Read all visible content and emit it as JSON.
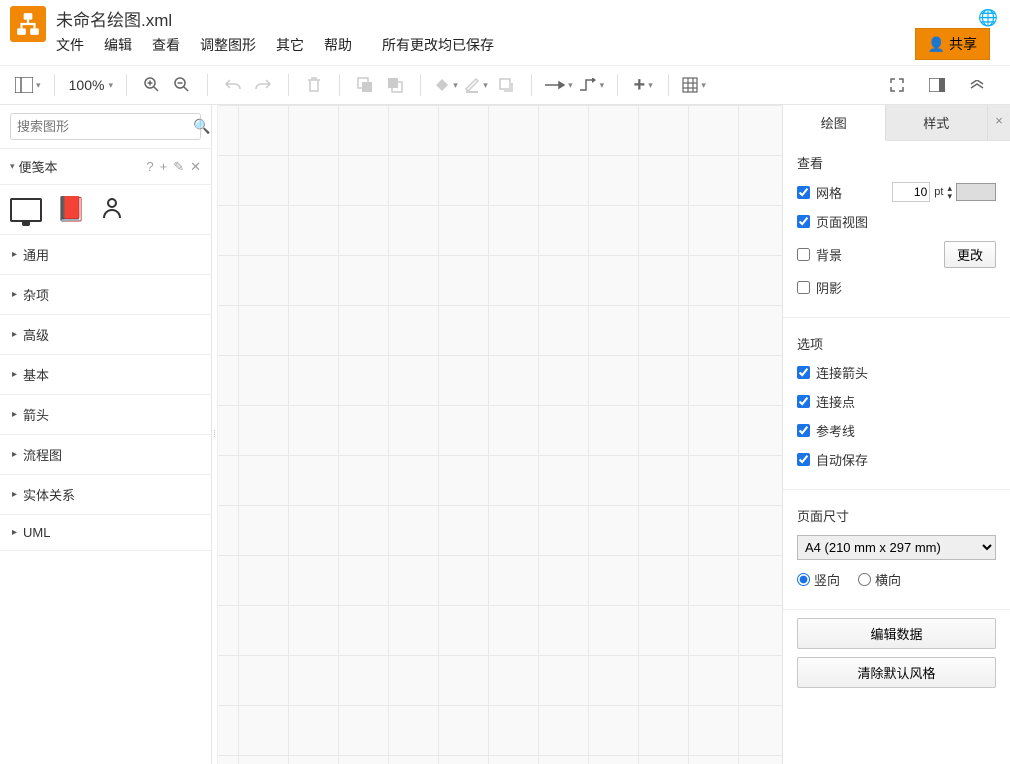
{
  "header": {
    "title": "未命名绘图.xml",
    "menu": [
      "文件",
      "编辑",
      "查看",
      "调整图形",
      "其它",
      "帮助"
    ],
    "save_status": "所有更改均已保存",
    "share_label": "共享"
  },
  "toolbar": {
    "zoom": "100%"
  },
  "sidebar": {
    "search_placeholder": "搜索图形",
    "notebook_label": "便笺本",
    "notebook_actions": [
      "?",
      "+",
      "✎",
      "✕"
    ],
    "categories": [
      "通用",
      "杂项",
      "高级",
      "基本",
      "箭头",
      "流程图",
      "实体关系",
      "UML"
    ]
  },
  "rpanel": {
    "tabs": {
      "draw": "绘图",
      "style": "样式"
    },
    "view": {
      "title": "查看",
      "grid": "网格",
      "grid_value": "10",
      "grid_unit": "pt",
      "pageview": "页面视图",
      "background": "背景",
      "change": "更改",
      "shadow": "阴影"
    },
    "options": {
      "title": "选项",
      "arrows": "连接箭头",
      "points": "连接点",
      "guides": "参考线",
      "autosave": "自动保存"
    },
    "page": {
      "title": "页面尺寸",
      "selected": "A4 (210 mm x 297 mm)",
      "portrait": "竖向",
      "landscape": "横向"
    },
    "buttons": {
      "edit_data": "编辑数据",
      "clear_styles": "清除默认风格"
    }
  }
}
